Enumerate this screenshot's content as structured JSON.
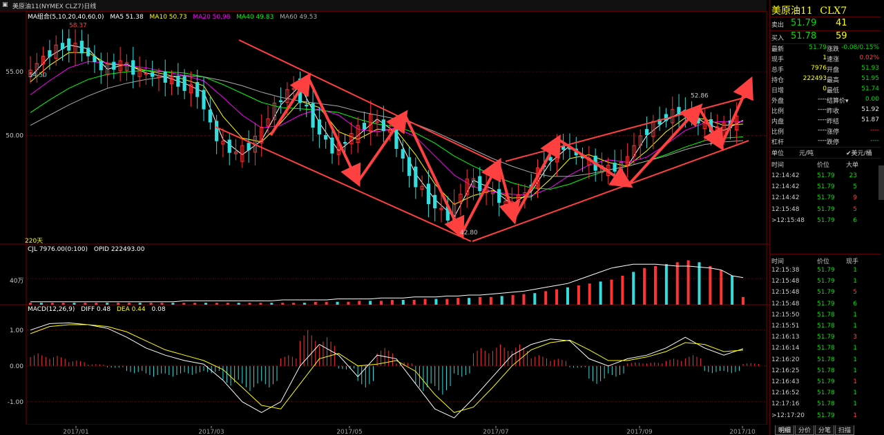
{
  "window": {
    "title": "美原油11(NYMEX CLZ7)日线"
  },
  "indicators": {
    "ma_label": "MA组合(5,10,20,40,60,0)",
    "ma5": "MA5 51.38",
    "ma10": "MA10 50.73",
    "ma20": "MA20 50.98",
    "ma40": "MA40 49.83",
    "ma60": "MA60 49.53",
    "cjl_label": "CJL 7976.00(0:100)",
    "opid_label": "OPID 222493.00",
    "macd_label": "MACD(12,26,9)",
    "diff": "DIFF 0.48",
    "dea": "DEA 0.44",
    "macd": "0.08",
    "days_label": "220天",
    "vol_unit": "40万"
  },
  "colors": {
    "up": "#ff3333",
    "down": "#33dddd",
    "ma5": "#ffffff",
    "ma10": "#ffff00",
    "ma20": "#ff00ff",
    "ma40": "#00ff00",
    "ma60": "#aaaaaa",
    "annotation": "#ff4040",
    "grid": "#7a0000"
  },
  "chart_data": [
    {
      "type": "candlestick",
      "title": "",
      "ylim": [
        41.5,
        59.0
      ],
      "yticks": [
        55.0,
        50.0
      ],
      "ytick_labels": [
        "55.00",
        "50.00"
      ],
      "annotations": [
        {
          "text": "58.37",
          "x": "2017/01",
          "y": 58.37
        },
        {
          "text": "54.50",
          "x": "2017/01",
          "y": 54.5
        },
        {
          "text": "42.80",
          "x": "2017/06",
          "y": 42.8
        },
        {
          "text": "52.86",
          "x": "2017/09",
          "y": 52.86
        }
      ],
      "xtick_labels": [
        "2017/01",
        "2017/03",
        "2017/05",
        "2017/07",
        "2017/09",
        "2017/10"
      ],
      "series": [
        {
          "name": "MA5",
          "values": [
            54.6,
            56.2,
            57.1,
            56.8,
            55.2,
            55.6,
            54.9,
            54.6,
            54.1,
            53.4,
            49.7,
            48.5,
            49.6,
            52.4,
            53.9,
            51.0,
            48.8,
            50.0,
            51.3,
            50.2,
            47.0,
            45.0,
            43.6,
            46.5,
            45.8,
            44.6,
            45.6,
            47.9,
            49.2,
            48.2,
            47.3,
            47.6,
            50.0,
            51.2,
            52.0,
            51.0,
            50.4,
            51.2
          ]
        },
        {
          "name": "MA10",
          "values": [
            54.2,
            55.5,
            56.5,
            56.5,
            55.6,
            55.5,
            55.1,
            54.8,
            54.4,
            53.9,
            51.5,
            49.8,
            49.5,
            51.0,
            52.7,
            52.2,
            50.3,
            49.7,
            50.5,
            50.4,
            48.5,
            46.2,
            44.6,
            45.3,
            45.7,
            45.1,
            45.2,
            46.6,
            48.2,
            48.5,
            47.9,
            47.6,
            48.8,
            50.3,
            51.4,
            51.3,
            50.8,
            50.9
          ]
        },
        {
          "name": "MA20",
          "values": [
            53.2,
            54.3,
            55.3,
            55.8,
            55.7,
            55.5,
            55.3,
            55.0,
            54.7,
            54.3,
            53.0,
            51.6,
            50.6,
            50.8,
            51.6,
            52.1,
            51.6,
            50.5,
            50.3,
            50.6,
            49.9,
            48.4,
            46.9,
            46.0,
            45.6,
            45.4,
            45.3,
            45.9,
            46.9,
            47.7,
            48.1,
            47.9,
            48.3,
            49.3,
            50.4,
            51.0,
            51.1,
            51.1
          ]
        },
        {
          "name": "MA40",
          "values": [
            51.8,
            52.8,
            53.7,
            54.4,
            54.8,
            55.0,
            55.1,
            55.0,
            54.9,
            54.6,
            54.0,
            53.3,
            52.6,
            52.2,
            52.1,
            52.0,
            51.8,
            51.3,
            50.9,
            50.7,
            50.2,
            49.4,
            48.4,
            47.6,
            46.9,
            46.3,
            45.9,
            45.8,
            46.2,
            46.8,
            47.3,
            47.6,
            48.0,
            48.5,
            49.1,
            49.6,
            49.8,
            49.9
          ]
        },
        {
          "name": "MA60",
          "values": [
            50.8,
            51.6,
            52.4,
            53.1,
            53.7,
            54.1,
            54.4,
            54.6,
            54.7,
            54.6,
            54.3,
            53.9,
            53.4,
            53.0,
            52.7,
            52.5,
            52.3,
            51.9,
            51.6,
            51.3,
            50.9,
            50.3,
            49.6,
            48.9,
            48.2,
            47.6,
            47.1,
            46.8,
            46.8,
            47.0,
            47.3,
            47.6,
            48.0,
            48.4,
            48.9,
            49.3,
            49.5,
            49.6
          ]
        }
      ]
    },
    {
      "type": "bar",
      "title": "",
      "series": [
        {
          "name": "CJL",
          "values": [
            2,
            2,
            2,
            2,
            2,
            2,
            2,
            2,
            2,
            2,
            2,
            2,
            2,
            2,
            2,
            2,
            2,
            2,
            2,
            2,
            2,
            2,
            2,
            2,
            2,
            2,
            3,
            3,
            3,
            3,
            4,
            4,
            4,
            5,
            5,
            5,
            6,
            6,
            6,
            7,
            7,
            8,
            8,
            9,
            10,
            11,
            12,
            14,
            16,
            18,
            20,
            22,
            24,
            26,
            30,
            34,
            38,
            40,
            42,
            44,
            46,
            44,
            40,
            36,
            30,
            8
          ]
        },
        {
          "name": "OPID",
          "values": [
            3,
            3,
            3,
            3,
            3,
            3,
            3,
            3,
            3,
            3,
            3,
            3,
            3,
            3,
            4,
            4,
            4,
            4,
            4,
            4,
            4,
            4,
            4,
            5,
            5,
            5,
            5,
            5,
            6,
            6,
            6,
            6,
            7,
            7,
            7,
            8,
            8,
            8,
            9,
            9,
            10,
            10,
            11,
            12,
            13,
            14,
            16,
            18,
            20,
            22,
            26,
            30,
            34,
            38,
            40,
            42,
            42,
            42,
            41,
            40,
            40,
            39,
            38,
            36,
            30,
            28
          ]
        }
      ]
    },
    {
      "type": "bar",
      "title": "",
      "ylim": [
        -1.6,
        1.4
      ],
      "yticks": [
        1.0,
        0.0,
        -1.0
      ],
      "ytick_labels": [
        "1.00",
        "0.00",
        "-1.00"
      ],
      "series": [
        {
          "name": "DIFF",
          "values": [
            1.0,
            1.18,
            1.2,
            1.15,
            1.05,
            0.8,
            0.5,
            0.3,
            0.15,
            0.05,
            -0.4,
            -1.0,
            -1.3,
            -1.0,
            0.0,
            0.6,
            0.3,
            -0.3,
            0.3,
            0.2,
            -0.5,
            -1.2,
            -1.45,
            -0.9,
            -0.3,
            0.3,
            0.6,
            0.75,
            0.7,
            0.2,
            0.0,
            0.2,
            0.3,
            0.5,
            0.8,
            0.5,
            0.3,
            0.48
          ]
        },
        {
          "name": "DEA",
          "values": [
            0.9,
            1.1,
            1.15,
            1.15,
            1.1,
            0.95,
            0.7,
            0.45,
            0.3,
            0.15,
            -0.1,
            -0.6,
            -1.1,
            -1.2,
            -0.5,
            0.2,
            0.35,
            0.0,
            0.05,
            0.15,
            -0.15,
            -0.8,
            -1.3,
            -1.15,
            -0.6,
            0.0,
            0.45,
            0.65,
            0.72,
            0.45,
            0.15,
            0.15,
            0.25,
            0.4,
            0.65,
            0.6,
            0.4,
            0.44
          ]
        },
        {
          "name": "MACD",
          "values": [
            0.35,
            0.28,
            0.15,
            0.05,
            -0.05,
            -0.2,
            -0.3,
            -0.3,
            -0.25,
            -0.2,
            -0.55,
            -0.7,
            -0.6,
            0.3,
            1.0,
            0.8,
            -0.1,
            -0.6,
            0.5,
            0.1,
            -0.7,
            -0.8,
            -0.3,
            0.5,
            0.6,
            0.6,
            0.3,
            0.2,
            -0.05,
            -0.5,
            -0.3,
            0.1,
            0.1,
            0.2,
            0.3,
            -0.2,
            -0.2,
            0.08
          ]
        }
      ]
    }
  ],
  "panel": {
    "contract_name": "美原油11",
    "contract_code": "CLX7",
    "sell_label": "卖出",
    "sell_price": "51.79",
    "sell_qty": "41",
    "buy_label": "买入",
    "buy_price": "51.78",
    "buy_qty": "59",
    "quote": [
      {
        "l1": "最新",
        "v1": "51.79",
        "c1": "green",
        "l2": "涨跌",
        "v2": "-0.08/0.15%",
        "c2": "green"
      },
      {
        "l1": "现手",
        "v1": "1",
        "c1": "yellow",
        "l2": "速涨",
        "v2": "0.02%",
        "c2": "red"
      },
      {
        "l1": "总手",
        "v1": "7976",
        "c1": "yellow",
        "l2": "开盘",
        "v2": "51.93",
        "c2": "green"
      },
      {
        "l1": "持仓",
        "v1": "222493",
        "c1": "yellow",
        "l2": "最高",
        "v2": "51.95",
        "c2": "green"
      },
      {
        "l1": "日增",
        "v1": "0",
        "c1": "yellow",
        "l2": "最低",
        "v2": "51.74",
        "c2": "green"
      },
      {
        "l1": "外盘",
        "v1": "----",
        "c1": "white",
        "l2": "结算价▾",
        "v2": "0.00",
        "c2": "green"
      },
      {
        "l1": "比例",
        "v1": "----",
        "c1": "white",
        "l2": "昨收",
        "v2": "51.92",
        "c2": "white"
      },
      {
        "l1": "内盘",
        "v1": "----",
        "c1": "white",
        "l2": "昨结",
        "v2": "51.87",
        "c2": "white"
      },
      {
        "l1": "比例",
        "v1": "----",
        "c1": "white",
        "l2": "涨停",
        "v2": "----",
        "c2": "red"
      },
      {
        "l1": "杠杆",
        "v1": "----",
        "c1": "white",
        "l2": "跌停",
        "v2": "----",
        "c2": "green"
      }
    ],
    "unit_label": "单位",
    "unit_value": "元/吨",
    "currency_label": "✔美元/桶",
    "ticks1_header": {
      "time": "时间",
      "price": "价位",
      "qty": "大单"
    },
    "ticks1": [
      {
        "time": "12:14:42",
        "price": "51.79",
        "qty": "23",
        "c": "green"
      },
      {
        "time": "12:14:42",
        "price": "51.79",
        "qty": "5",
        "c": "green"
      },
      {
        "time": "12:14:42",
        "price": "51.79",
        "qty": "9",
        "c": "red"
      },
      {
        "time": "12:15:48",
        "price": "51.79",
        "qty": "5",
        "c": "red"
      },
      {
        "time": ">12:15:48",
        "price": "51.79",
        "qty": "6",
        "c": "green"
      }
    ],
    "ticks2_header": {
      "time": "时间",
      "price": "价位",
      "qty": "现手"
    },
    "ticks2": [
      {
        "time": "12:15:38",
        "price": "51.79",
        "qty": "1",
        "c": "green"
      },
      {
        "time": "12:15:48",
        "price": "51.79",
        "qty": "1",
        "c": "green"
      },
      {
        "time": "12:15:48",
        "price": "51.79",
        "qty": "5",
        "c": "red"
      },
      {
        "time": "12:15:48",
        "price": "51.79",
        "qty": "6",
        "c": "green"
      },
      {
        "time": "12:15:50",
        "price": "51.78",
        "qty": "1",
        "c": "green"
      },
      {
        "time": "12:15:51",
        "price": "51.78",
        "qty": "1",
        "c": "green"
      },
      {
        "time": "12:16:13",
        "price": "51.79",
        "qty": "3",
        "c": "red"
      },
      {
        "time": "12:16:14",
        "price": "51.78",
        "qty": "1",
        "c": "green"
      },
      {
        "time": "12:16:20",
        "price": "51.78",
        "qty": "1",
        "c": "green"
      },
      {
        "time": "12:16:25",
        "price": "51.78",
        "qty": "1",
        "c": "green"
      },
      {
        "time": "12:16:43",
        "price": "51.79",
        "qty": "1",
        "c": "red"
      },
      {
        "time": "12:16:52",
        "price": "51.78",
        "qty": "1",
        "c": "green"
      },
      {
        "time": "12:17:16",
        "price": "51.78",
        "qty": "1",
        "c": "green"
      },
      {
        "time": ">12:17:20",
        "price": "51.79",
        "qty": "1",
        "c": "red"
      }
    ],
    "tabs": [
      "明细",
      "分价",
      "分笔",
      "扫描"
    ]
  }
}
